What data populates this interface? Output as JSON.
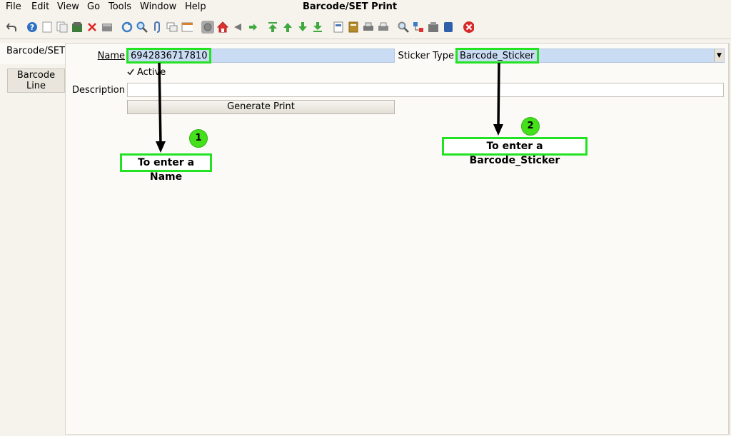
{
  "menu": {
    "file": "File",
    "edit": "Edit",
    "view": "View",
    "go": "Go",
    "tools": "Tools",
    "window": "Window",
    "help": "Help"
  },
  "window_title": "Barcode/SET Print",
  "toolbar_icons": [
    "undo-icon",
    "help-icon",
    "new-icon",
    "copy-icon",
    "save-icon",
    "delete-icon",
    "grid-icon",
    "refresh-icon",
    "find-icon",
    "attachment-icon",
    "chat-icon",
    "history-icon",
    "parent-icon",
    "home-icon",
    "back-icon",
    "forward-icon",
    "first-icon",
    "previous-icon",
    "next-icon",
    "last-icon",
    "report-icon",
    "archive-icon",
    "print-icon",
    "print-preview-icon",
    "zoom-across-icon",
    "workflow-icon",
    "product-info-icon",
    "request-icon",
    "close-window-icon"
  ],
  "tabs": {
    "barcode_set": "Barcode/SET",
    "barcode_line_1": "Barcode",
    "barcode_line_2": "Line"
  },
  "form": {
    "name_label": "Name",
    "name_value": "6942836717810",
    "sticker_type_label": "Sticker Type",
    "sticker_type_value": "Barcode_Sticker",
    "active_label": "Active",
    "active_checked": true,
    "description_label": "Description",
    "description_value": "",
    "generate_button": "Generate Print"
  },
  "annotations": {
    "badge_1": "1",
    "callout_1": "To enter a Name",
    "badge_2": "2",
    "callout_2": "To enter a Barcode_Sticker"
  },
  "colors": {
    "mandatory_field": "#c9dcf3",
    "highlight_green": "#22e322",
    "badge_green": "#44e01c",
    "background": "#f6f3ec"
  }
}
